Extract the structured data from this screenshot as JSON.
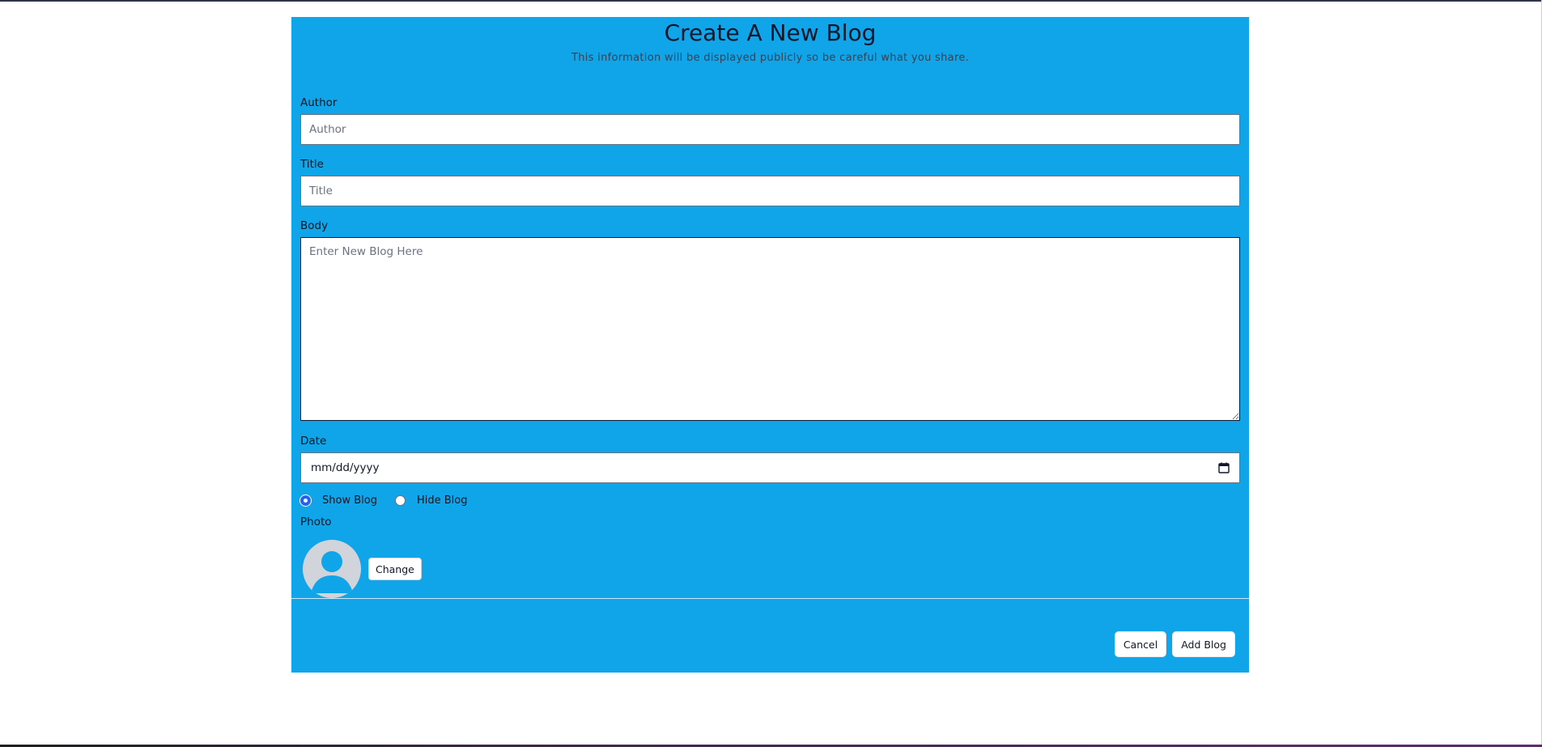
{
  "header": {
    "title": "Create A New Blog",
    "subtitle": "This information will be displayed publicly so be careful what you share."
  },
  "form": {
    "author": {
      "label": "Author",
      "placeholder": "Author",
      "value": ""
    },
    "title": {
      "label": "Title",
      "placeholder": "Title",
      "value": ""
    },
    "body": {
      "label": "Body",
      "placeholder": "Enter New Blog Here",
      "value": ""
    },
    "date": {
      "label": "Date",
      "placeholder": "mm/dd/yyyy"
    },
    "visibility": {
      "options": [
        {
          "label": "Show Blog",
          "checked": true
        },
        {
          "label": "Hide Blog",
          "checked": false
        }
      ]
    },
    "photo": {
      "label": "Photo",
      "change_label": "Change"
    }
  },
  "footer": {
    "cancel_label": "Cancel",
    "submit_label": "Add Blog"
  },
  "colors": {
    "panel_background": "#10a5e8",
    "radio_accent": "#2563eb",
    "avatar_background": "#d1d5db"
  },
  "icons": {
    "date_picker": "calendar-icon",
    "avatar": "user-silhouette-icon"
  }
}
